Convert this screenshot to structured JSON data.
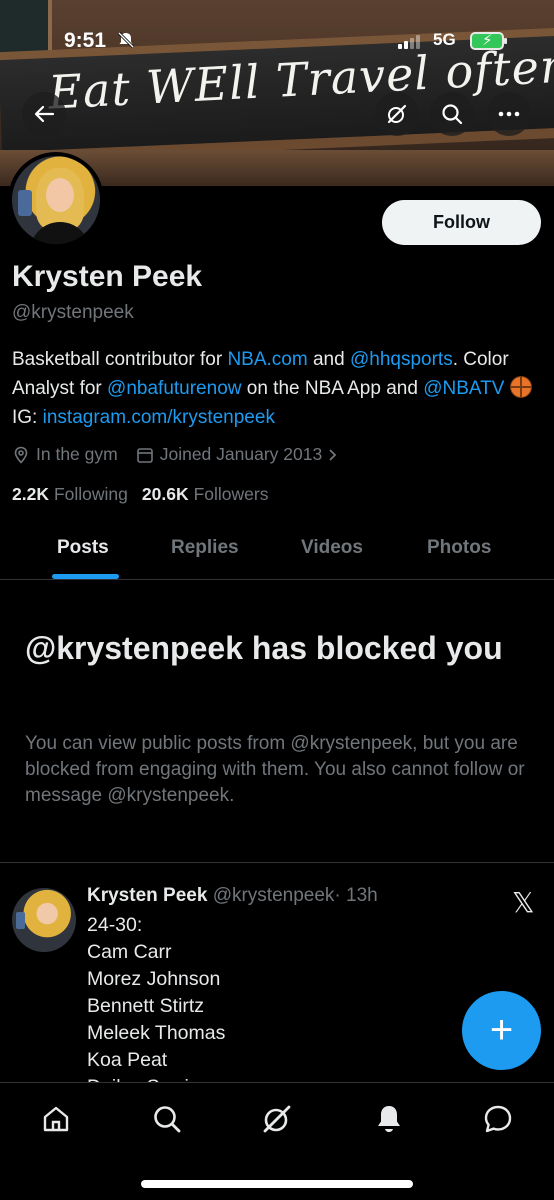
{
  "status_bar": {
    "time": "9:51",
    "network": "5G",
    "battery_state": "charging"
  },
  "banner": {
    "sign_text": "Eat WEll Travel often"
  },
  "profile": {
    "follow_label": "Follow",
    "name": "Krysten Peek",
    "handle": "@krystenpeek",
    "bio": {
      "t1": "Basketball contributor for ",
      "l1": "NBA.com",
      "t2": " and ",
      "l2": "@hhqsports",
      "t3": ". Color Analyst for ",
      "l3": "@nbafuturenow",
      "t4": " on the NBA App and ",
      "l4": "@NBATV",
      "t5": " IG: ",
      "l5": "instagram.com/krystenpeek"
    },
    "location": "In the gym",
    "joined": "Joined January 2013",
    "following_count": "2.2K",
    "following_label": "Following",
    "followers_count": "20.6K",
    "followers_label": "Followers"
  },
  "tabs": [
    {
      "label": "Posts",
      "active": true
    },
    {
      "label": "Replies",
      "active": false
    },
    {
      "label": "Videos",
      "active": false
    },
    {
      "label": "Photos",
      "active": false
    }
  ],
  "blocked": {
    "title": "@krystenpeek has blocked you",
    "description": "You can view public posts from @krystenpeek, but you are blocked from engaging with them. You also cannot follow or message @krystenpeek."
  },
  "post": {
    "author_name": "Krysten Peek",
    "author_handle": "@krystenpeek",
    "time": "· 13h",
    "lines": [
      "24-30:",
      "Cam Carr",
      "Morez Johnson",
      "Bennett Stirtz",
      "Meleek Thomas",
      "Koa Peat",
      "Dailyn Swain"
    ]
  },
  "fab_label": "+",
  "colors": {
    "accent": "#1d9bf0",
    "background": "#000000",
    "text_primary": "#e7e9ea",
    "text_secondary": "#71767b"
  },
  "icons": [
    "back-arrow-icon",
    "grok-icon",
    "search-icon",
    "more-icon",
    "location-icon",
    "calendar-icon",
    "chevron-right-icon",
    "x-logo-icon",
    "home-icon",
    "explore-icon",
    "grok-nav-icon",
    "notifications-icon",
    "messages-icon"
  ]
}
